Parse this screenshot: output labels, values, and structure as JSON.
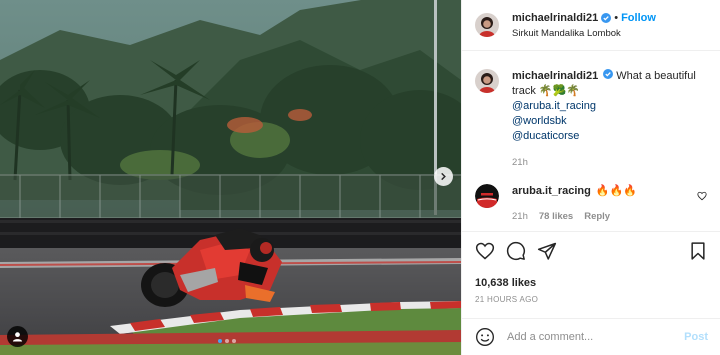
{
  "post": {
    "username": "michaelrinaldi21",
    "follow_label": "Follow",
    "separator": "•",
    "location": "Sirkuit Mandalika Lombok",
    "caption_text": "What a beautiful track 🌴🥦🌴",
    "mentions": [
      "@aruba.it_racing",
      "@worldsbk",
      "@ducaticorse"
    ],
    "caption_time": "21h"
  },
  "reply": {
    "username": "aruba.it_racing",
    "text": "🔥🔥🔥",
    "time": "21h",
    "likes": "78 likes",
    "reply_label": "Reply"
  },
  "stats": {
    "likes": "10,638 likes",
    "posted": "21 HOURS AGO"
  },
  "composer": {
    "placeholder": "Add a comment...",
    "post_label": "Post"
  },
  "carousel": {
    "total": 3,
    "active_index": 1
  },
  "colors": {
    "accent": "#0095f6",
    "verified": "#3897f0",
    "mention": "#00376b",
    "muted": "#8e8e8e"
  },
  "icons": [
    "verified-badge-icon",
    "chevron-right-icon",
    "user-tag-icon",
    "heart-icon",
    "comment-icon",
    "share-icon",
    "bookmark-icon",
    "emoji-icon"
  ]
}
